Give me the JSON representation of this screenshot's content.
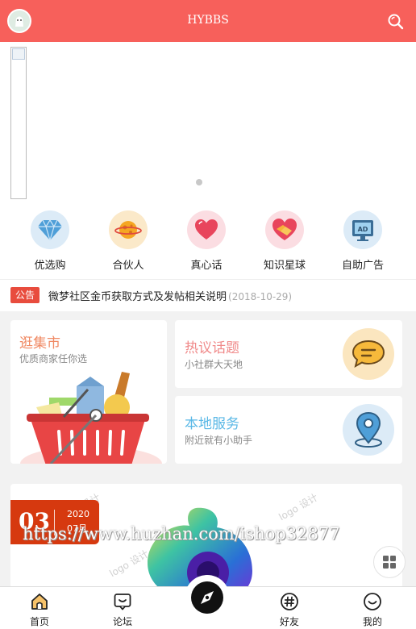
{
  "header": {
    "title": "HYBBS"
  },
  "nav": [
    {
      "label": "优选购",
      "icon": "diamond-icon"
    },
    {
      "label": "合伙人",
      "icon": "planet-icon"
    },
    {
      "label": "真心话",
      "icon": "heart-icon"
    },
    {
      "label": "知识星球",
      "icon": "handshake-icon"
    },
    {
      "label": "自助广告",
      "icon": "ad-board-icon"
    }
  ],
  "notice": {
    "tag": "公告",
    "text": "微梦社区金币获取方式及发帖相关说明",
    "date": "(2018-10-29)"
  },
  "cards": {
    "market": {
      "title": "逛集市",
      "subtitle": "优质商家任你选"
    },
    "hot": {
      "title": "热议话题",
      "subtitle": "小社群大天地"
    },
    "local": {
      "title": "本地服务",
      "subtitle": "附近就有小助手"
    }
  },
  "feature": {
    "day": "03",
    "year": "2020",
    "month": "07月",
    "overlay": "https://www.huzhan.com/ishop32877"
  },
  "tabs": [
    {
      "label": "首页",
      "icon": "home-icon"
    },
    {
      "label": "论坛",
      "icon": "chat-icon"
    },
    {
      "label": "",
      "icon": "compass-icon"
    },
    {
      "label": "好友",
      "icon": "hash-icon"
    },
    {
      "label": "我的",
      "icon": "smile-icon"
    }
  ],
  "colors": {
    "header": "#f7605b",
    "notice_tag": "#e84c3d",
    "date_badge": "#d6390f"
  }
}
